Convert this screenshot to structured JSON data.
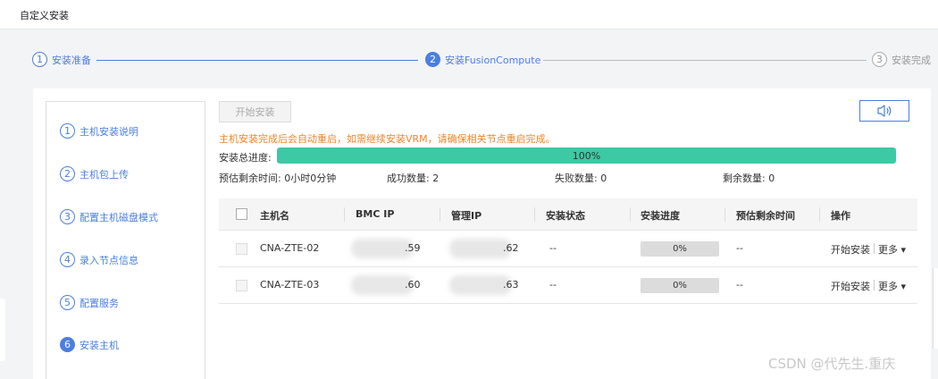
{
  "window": {
    "title": "自定义安装"
  },
  "steps": [
    {
      "num": "1",
      "label": "安装准备",
      "state": "done"
    },
    {
      "num": "2",
      "label": "安装FusionCompute",
      "state": "active"
    },
    {
      "num": "3",
      "label": "安装完成",
      "state": "pending"
    }
  ],
  "subnav": [
    {
      "num": "1",
      "label": "主机安装说明"
    },
    {
      "num": "2",
      "label": "主机包上传"
    },
    {
      "num": "3",
      "label": "配置主机磁盘模式"
    },
    {
      "num": "4",
      "label": "录入节点信息"
    },
    {
      "num": "5",
      "label": "配置服务"
    },
    {
      "num": "6",
      "label": "安装主机",
      "active": true
    }
  ],
  "toolbar": {
    "start_label": "开始安装",
    "sound_icon": "speaker-icon"
  },
  "notice": "主机安装完成后会自动重启，如需继续安装VRM，请确保相关节点重启完成。",
  "progress": {
    "label": "安装总进度:",
    "percent": 100,
    "text": "100%"
  },
  "stats": {
    "remaining_time": "预估剩余时间: 0小时0分钟",
    "success": "成功数量: 2",
    "failed": "失败数量: 0",
    "remaining": "剩余数量: 0"
  },
  "table": {
    "headers": [
      "主机名",
      "BMC IP",
      "管理IP",
      "安装状态",
      "安装进度",
      "预估剩余时间",
      "操作"
    ],
    "rows": [
      {
        "host": "CNA-ZTE-02",
        "bmc": ".59",
        "mgmt": ".62",
        "status": "--",
        "progress": "0%",
        "remaining": "--",
        "op_start": "开始安装",
        "op_more": "更多 ▾"
      },
      {
        "host": "CNA-ZTE-03",
        "bmc": ".60",
        "mgmt": ".63",
        "status": "--",
        "progress": "0%",
        "remaining": "--",
        "op_start": "开始安装",
        "op_more": "更多 ▾"
      }
    ]
  },
  "watermark": "CSDN @代先生.重庆",
  "colors": {
    "accent": "#4a7fe0",
    "progress": "#3dc9a3",
    "notice": "#f0852a"
  }
}
